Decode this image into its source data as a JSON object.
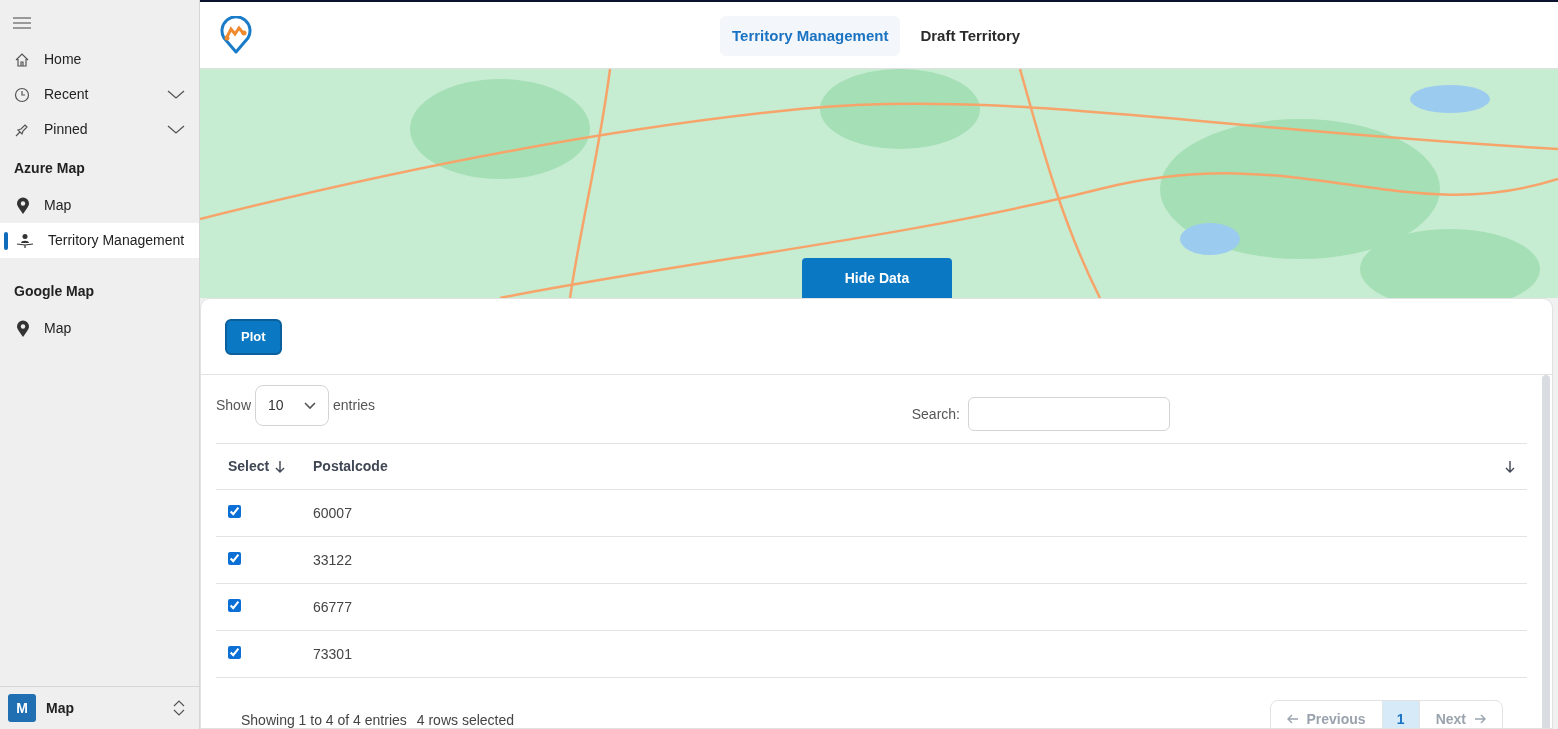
{
  "sidebar": {
    "top_items": [
      {
        "kind": "link",
        "label": "Home"
      },
      {
        "kind": "group",
        "label": "Recent",
        "expanded": false
      },
      {
        "kind": "group",
        "label": "Pinned",
        "expanded": false
      }
    ],
    "sections": [
      {
        "title": "Azure Map",
        "items": [
          {
            "kind": "location",
            "label": "Map",
            "selected": false
          },
          {
            "kind": "territory",
            "label": "Territory Management",
            "selected": true
          }
        ]
      },
      {
        "title": "Google Map",
        "items": [
          {
            "kind": "location",
            "label": "Map",
            "selected": false
          }
        ]
      }
    ],
    "footer": {
      "badge": "M",
      "label": "Map"
    }
  },
  "tabs": [
    {
      "label": "Territory Management",
      "selected": true
    },
    {
      "label": "Draft Territory",
      "selected": false
    }
  ],
  "hide_button": "Hide Data",
  "plot_button": "Plot",
  "table": {
    "show_label": "Show",
    "page_size": "10",
    "entries_label": "entries",
    "search_label": "Search:",
    "columns": [
      {
        "label": "Select"
      },
      {
        "label": "Postalcode"
      }
    ],
    "rows": [
      {
        "checked": true,
        "postalcode": "60007"
      },
      {
        "checked": true,
        "postalcode": "33122"
      },
      {
        "checked": true,
        "postalcode": "66777"
      },
      {
        "checked": true,
        "postalcode": "73301"
      }
    ],
    "info": "Showing 1 to 4 of 4 entries",
    "selection_info": "4 rows selected",
    "pagination": {
      "previous": {
        "label": "Previous",
        "disabled": true
      },
      "pages": [
        {
          "label": "1",
          "selected": true
        }
      ],
      "next": {
        "label": "Next",
        "disabled": true
      }
    }
  }
}
